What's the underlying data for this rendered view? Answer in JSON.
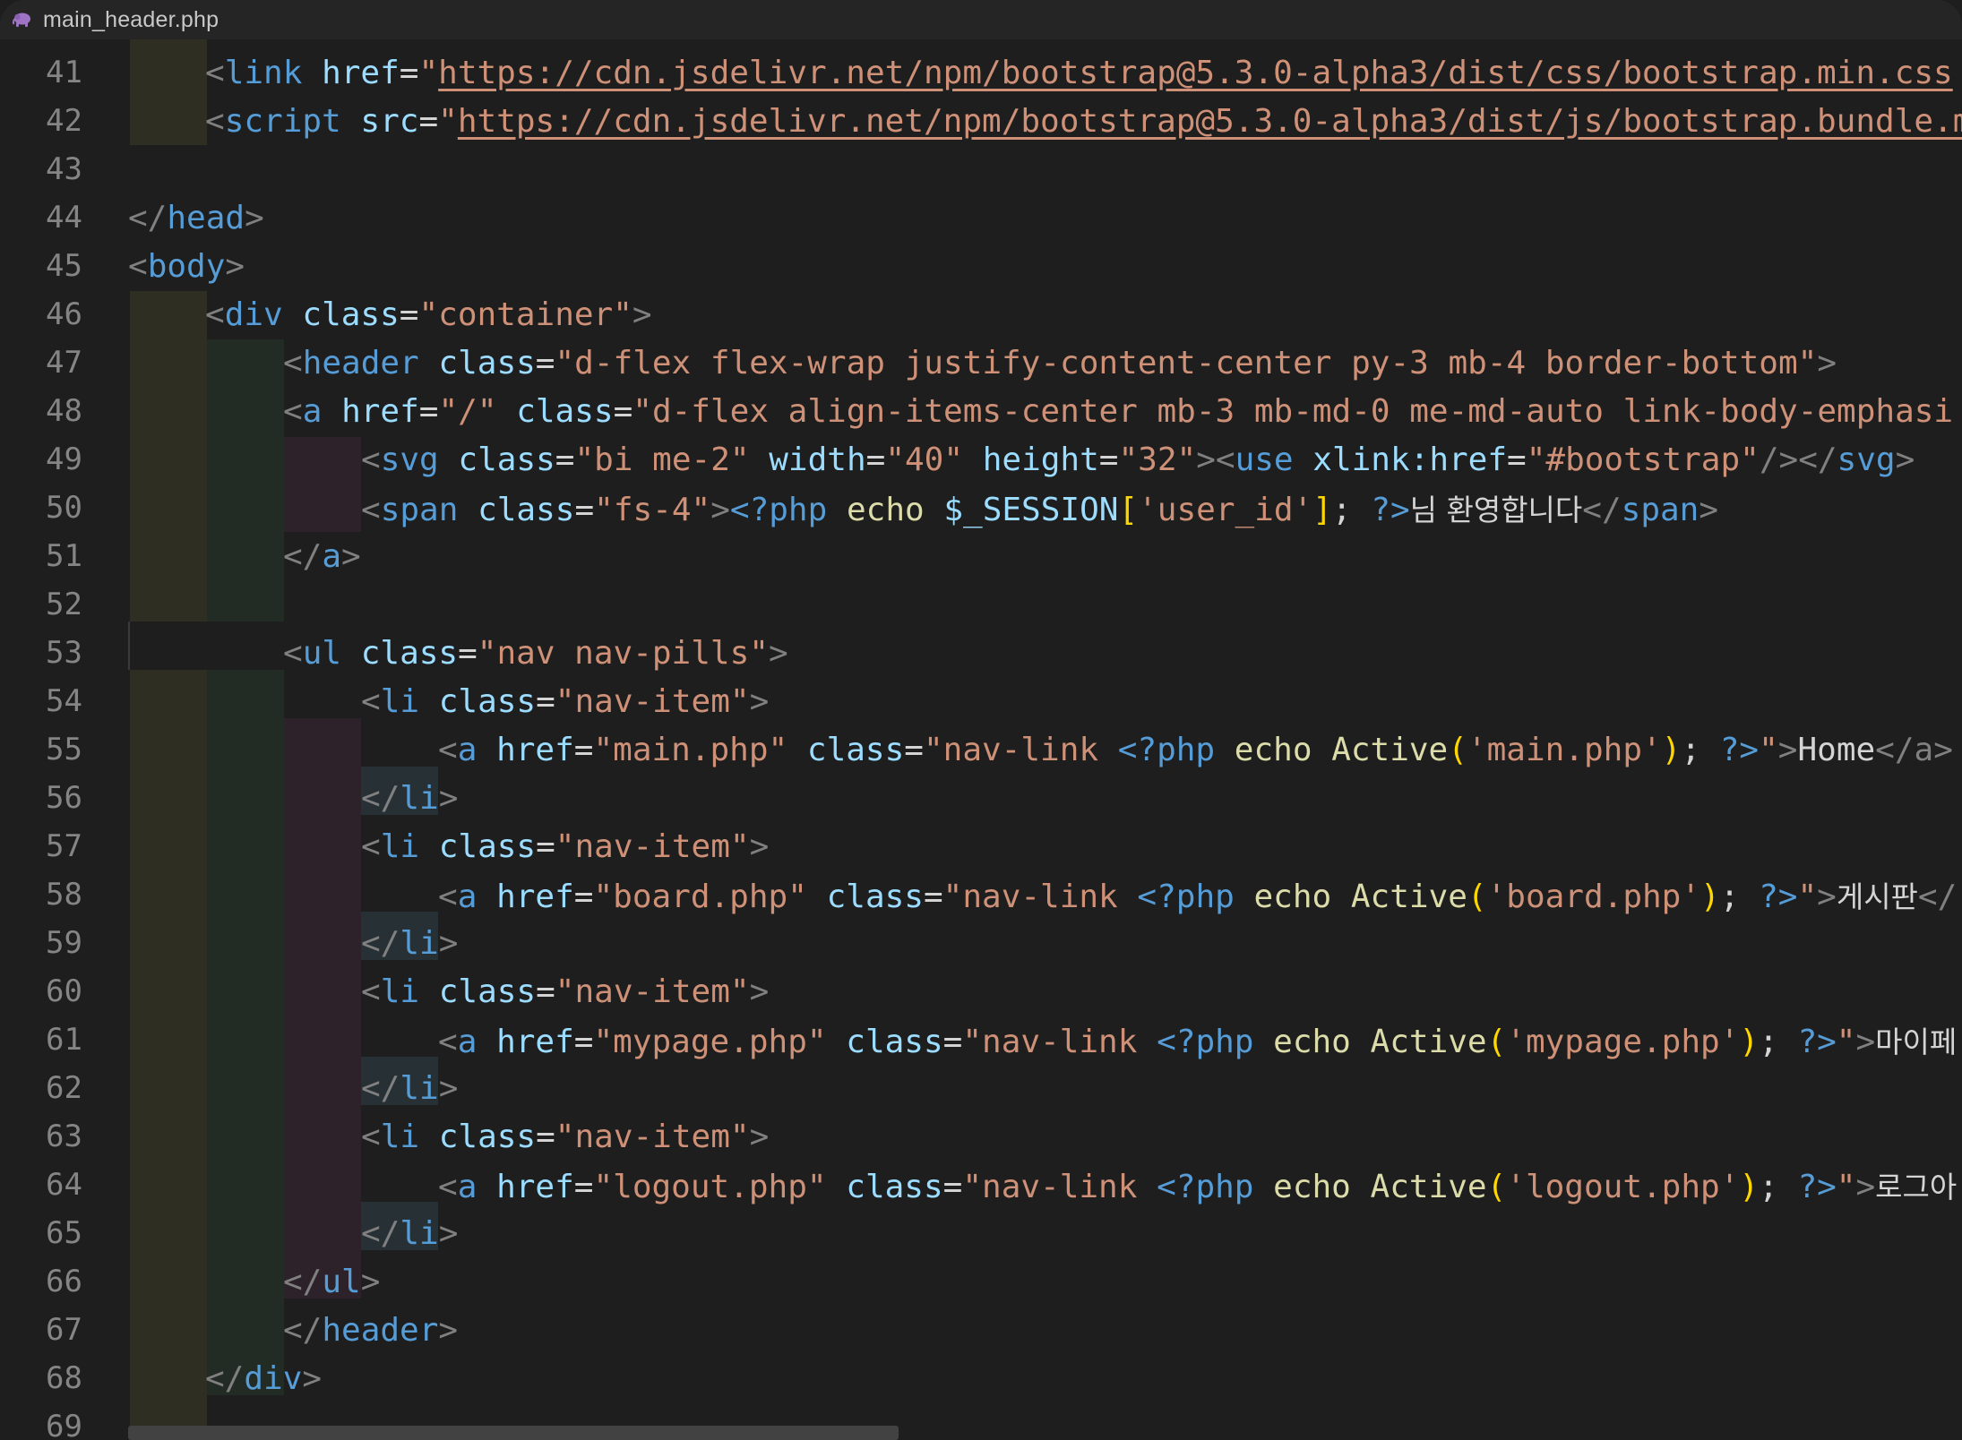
{
  "window": {
    "filename": "main_header.php",
    "file_icon": "php-elephant-icon",
    "accent_icon_color": "#a074c4"
  },
  "line_numbers": [
    "41",
    "42",
    "43",
    "44",
    "45",
    "46",
    "47",
    "48",
    "49",
    "50",
    "51",
    "52",
    "53",
    "54",
    "55",
    "56",
    "57",
    "58",
    "59",
    "60",
    "61",
    "62",
    "63",
    "64",
    "65",
    "66",
    "67",
    "68",
    "69"
  ],
  "code": {
    "l41": {
      "tag": "link",
      "attr": "href",
      "url": "https://cdn.jsdelivr.net/npm/bootstrap@5.3.0-alpha3/dist/css/bootstrap.min.css"
    },
    "l42": {
      "tag": "script",
      "attr": "src",
      "url": "https://cdn.jsdelivr.net/npm/bootstrap@5.3.0-alpha3/dist/js/bootstrap.bundle.m"
    },
    "l44": {
      "tag": "head"
    },
    "l45": {
      "tag": "body"
    },
    "l46": {
      "tag": "div",
      "attr": "class",
      "value": "container"
    },
    "l47": {
      "tag": "header",
      "attr": "class",
      "value": "d-flex flex-wrap justify-content-center py-3 mb-4 border-bottom"
    },
    "l48": {
      "tag": "a",
      "attr1": "href",
      "value1": "/",
      "attr2": "class",
      "value2": "d-flex align-items-center mb-3 mb-md-0 me-md-auto link-body-emphasi"
    },
    "l49": {
      "tag": "svg",
      "attr1": "class",
      "value1": "bi me-2",
      "attr2": "width",
      "value2": "40",
      "attr3": "height",
      "value3": "32",
      "use_tag": "use",
      "use_attr": "xlink:href",
      "use_value": "#bootstrap"
    },
    "l50": {
      "tag": "span",
      "attr": "class",
      "value": "fs-4",
      "php_open": "<?php",
      "echo": "echo",
      "var": "$_SESSION",
      "key": "'user_id'",
      "php_close": "?>",
      "text": "님 환영합니다"
    },
    "l51": {
      "tag": "a"
    },
    "l53": {
      "tag": "ul",
      "attr": "class",
      "value": "nav nav-pills"
    },
    "nav_item_class": "nav-item",
    "nav_links": [
      {
        "href": "main.php",
        "arg": "'main.php'",
        "text": "Home",
        "tail": "</a>"
      },
      {
        "href": "board.php",
        "arg": "'board.php'",
        "text": "게시판",
        "tail": "</"
      },
      {
        "href": "mypage.php",
        "arg": "'mypage.php'",
        "text": "마이페",
        "tail": ""
      },
      {
        "href": "logout.php",
        "arg": "'logout.php'",
        "text": "로그아",
        "tail": ""
      }
    ],
    "nav_link_class": "nav-link ",
    "fn_name": "Active",
    "l66": {
      "tag": "ul"
    },
    "l67": {
      "tag": "header"
    },
    "l68": {
      "tag": "div"
    }
  }
}
